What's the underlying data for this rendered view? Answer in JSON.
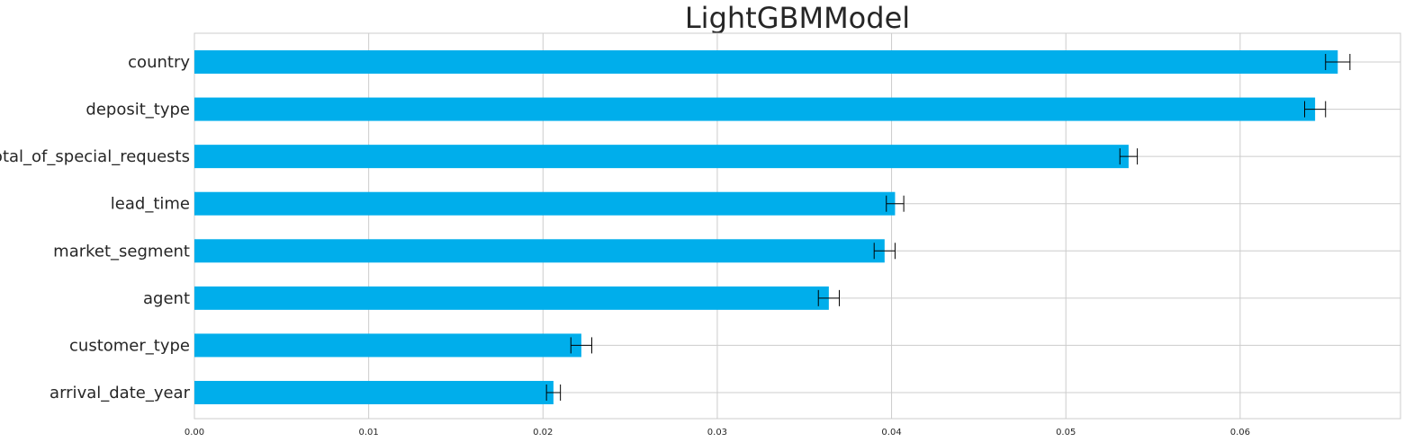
{
  "chart_data": {
    "type": "bar",
    "orientation": "horizontal",
    "title": "LightGBMModel",
    "xlabel": "",
    "ylabel": "",
    "categories": [
      "country",
      "deposit_type",
      "total_of_special_requests",
      "lead_time",
      "market_segment",
      "agent",
      "customer_type",
      "arrival_date_year"
    ],
    "values": [
      0.0656,
      0.0643,
      0.0536,
      0.0402,
      0.0396,
      0.0364,
      0.0222,
      0.0206
    ],
    "errors": [
      0.0007,
      0.0006,
      0.0005,
      0.0005,
      0.0006,
      0.0006,
      0.0006,
      0.0004
    ],
    "xlim": [
      0,
      0.0692
    ],
    "xticks": [
      "0.00",
      "0.01",
      "0.02",
      "0.03",
      "0.04",
      "0.05",
      "0.06"
    ],
    "xtick_values": [
      0,
      0.01,
      0.02,
      0.03,
      0.04,
      0.05,
      0.06
    ],
    "grid": true,
    "colors": {
      "bar": "#00AEEB",
      "error": "#000000",
      "grid": "#cccccc",
      "frame": "#cccccc",
      "text": "#262626"
    }
  }
}
